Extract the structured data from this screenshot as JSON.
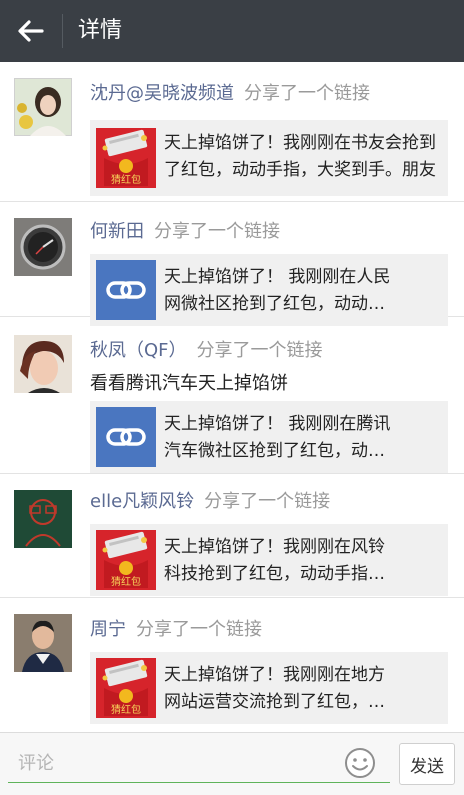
{
  "header": {
    "back_icon": "back-arrow-icon",
    "title": "详情"
  },
  "posts": [
    {
      "author": "沈丹@吴晓波频道",
      "action": "分享了一个链接",
      "caption": "",
      "card": {
        "thumb": "red-envelope-thumbnail",
        "thumb_label": "猜红包",
        "lines": [
          "天上掉馅饼了！我刚刚在书友会抢到",
          "了红包，动动手指，大奖到手。朋友"
        ]
      }
    },
    {
      "author": "何新田",
      "action": "分享了一个链接",
      "caption": "",
      "card": {
        "thumb": "link-icon",
        "thumb_label": "",
        "lines": [
          "天上掉馅饼了！ 我刚刚在人民",
          "网微社区抢到了红包，动动…"
        ]
      }
    },
    {
      "author": "秋凤（QF）",
      "action": "分享了一个链接",
      "caption": "看看腾讯汽车天上掉馅饼",
      "card": {
        "thumb": "link-icon",
        "thumb_label": "",
        "lines": [
          "天上掉馅饼了！ 我刚刚在腾讯",
          "汽车微社区抢到了红包，动…"
        ]
      }
    },
    {
      "author": "elle凡颖风铃",
      "action": "分享了一个链接",
      "caption": "",
      "card": {
        "thumb": "red-envelope-thumbnail",
        "thumb_label": "猜红包",
        "lines": [
          "天上掉馅饼了！我刚刚在风铃",
          "科技抢到了红包，动动手指…"
        ]
      }
    },
    {
      "author": "周宁",
      "action": "分享了一个链接",
      "caption": "",
      "card": {
        "thumb": "red-envelope-thumbnail",
        "thumb_label": "猜红包",
        "lines": [
          "天上掉馅饼了！我刚刚在地方",
          "网站运营交流抢到了红包，…"
        ]
      }
    }
  ],
  "footer": {
    "comment_placeholder": "评论",
    "emoji_icon": "smiley-icon",
    "send_label": "发送"
  },
  "colors": {
    "titlebar": "#3a3f45",
    "author_name": "#5b6a92",
    "link_tile": "#4a76c0",
    "envelope_red": "#d6242b",
    "input_underline": "#5fb35a"
  }
}
